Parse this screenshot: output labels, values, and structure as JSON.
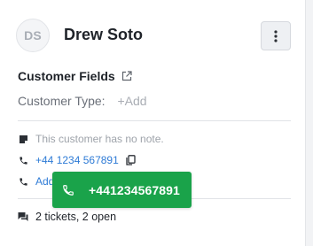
{
  "contact": {
    "initials": "DS",
    "name": "Drew Soto"
  },
  "customer_fields": {
    "title": "Customer Fields",
    "type_label": "Customer Type:",
    "type_add": "+Add"
  },
  "details": {
    "note": "This customer has no note.",
    "phone": "+44 1234 567891",
    "add_phone": "Add",
    "tickets": "2 tickets, 2 open"
  },
  "tooltip": {
    "phone": "+441234567891"
  },
  "colors": {
    "accent_green": "#1aa34a",
    "link_blue": "#2e7bd6"
  }
}
